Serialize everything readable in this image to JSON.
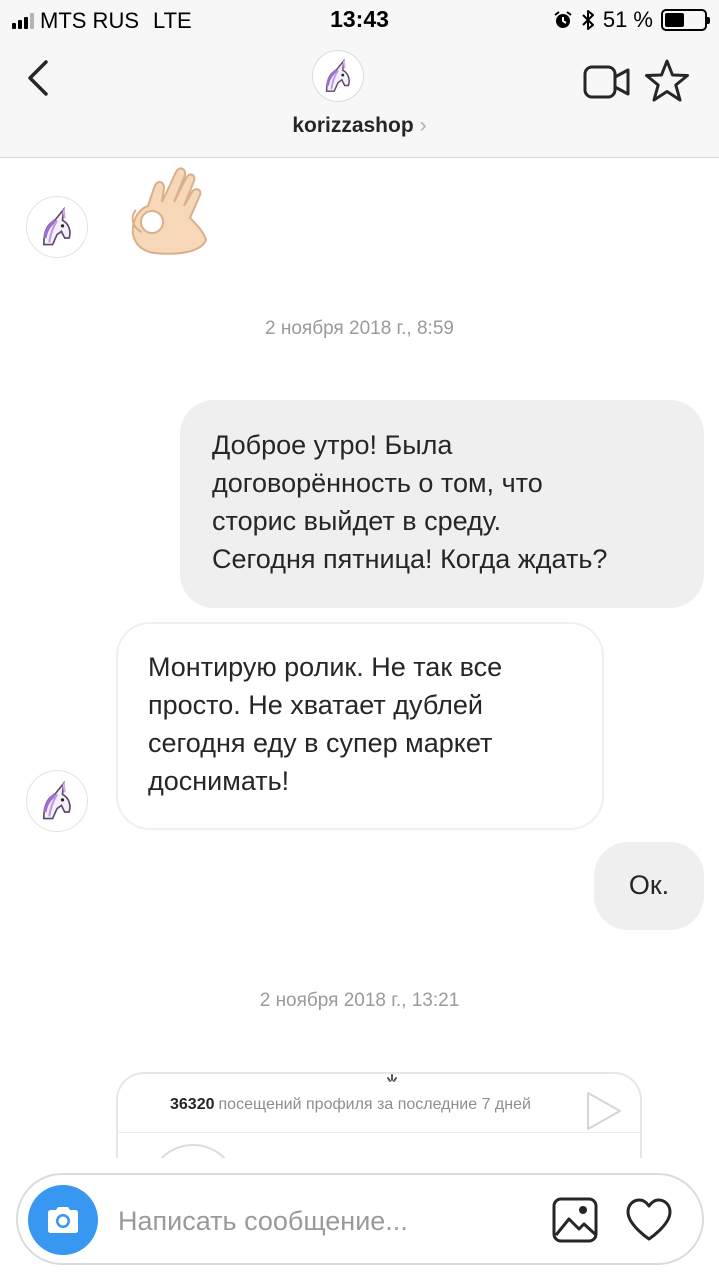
{
  "status_bar": {
    "carrier": "MTS RUS",
    "network": "LTE",
    "time": "13:43",
    "battery": "51 %",
    "battery_fraction": 0.51
  },
  "header": {
    "username": "korizzashop",
    "username_chevron": "›",
    "icons": [
      "back-icon",
      "unicorn-avatar-icon",
      "video-camera-icon",
      "star-icon"
    ]
  },
  "messages": [
    {
      "type": "emoji",
      "from": "them",
      "icon": "ok-hand-emoji"
    },
    {
      "type": "timestamp",
      "text": "2 ноября 2018 г., 8:59"
    },
    {
      "type": "text",
      "from": "me",
      "lines": [
        "Доброе утро! Была",
        "договорённость о том, что",
        "сторис выйдет в среду.",
        "Сегодня пятница! Когда ждать?"
      ]
    },
    {
      "type": "text",
      "from": "them",
      "lines": [
        "Монтирую ролик. Не так все",
        "просто. Не хватает дублей",
        "сегодня еду в супер маркет",
        "доснимать!"
      ]
    },
    {
      "type": "text",
      "from": "me",
      "text": "Ок."
    },
    {
      "type": "timestamp",
      "text": "2 ноября 2018 г., 13:21"
    },
    {
      "type": "shared_post",
      "from": "them",
      "stat_number": "36320",
      "stat_text": "посещений профиля за последние 7 дней"
    }
  ],
  "composer": {
    "placeholder": "Написать сообщение...",
    "icons": [
      "camera-icon",
      "gallery-icon",
      "heart-icon"
    ]
  },
  "colors": {
    "accent_blue": "#3897f0",
    "bubble_grey": "#efefef",
    "header_bg": "#f7f7f7",
    "muted_text": "#9a9a9a"
  }
}
